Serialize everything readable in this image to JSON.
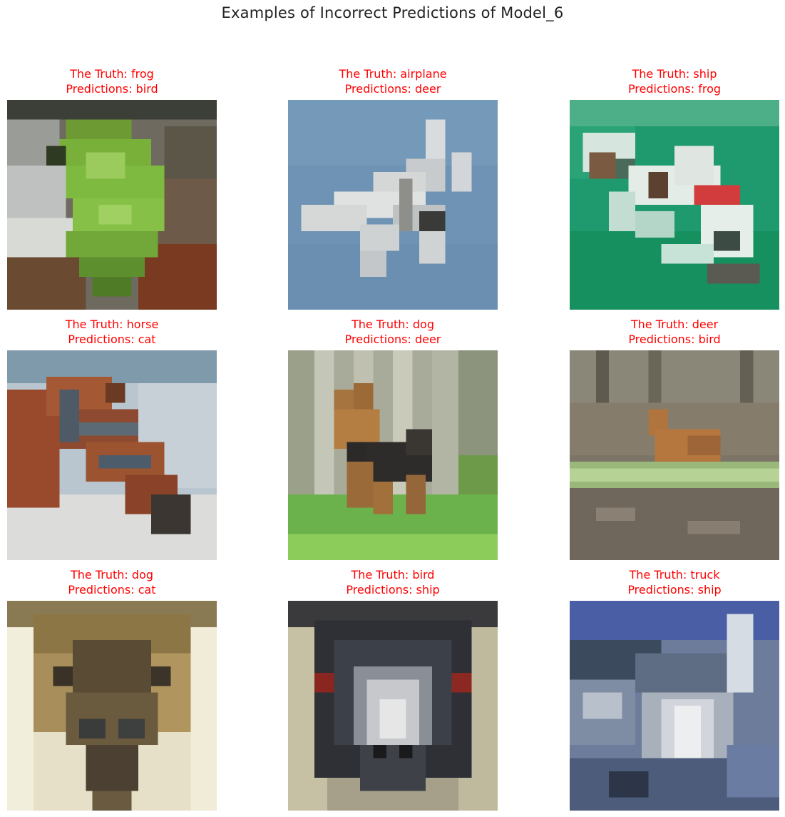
{
  "title": "Examples of Incorrect Predictions of Model_6",
  "panels": [
    {
      "truth": "The Truth: frog",
      "prediction": "Predictions: bird",
      "scene": "green-frog-on-rock"
    },
    {
      "truth": "The Truth: airplane",
      "prediction": "Predictions: deer",
      "scene": "white-jet-in-blue-sky"
    },
    {
      "truth": "The Truth: ship",
      "prediction": "Predictions: frog",
      "scene": "boat-on-green-water"
    },
    {
      "truth": "The Truth: horse",
      "prediction": "Predictions: cat",
      "scene": "brown-horse-head"
    },
    {
      "truth": "The Truth: dog",
      "prediction": "Predictions: deer",
      "scene": "terrier-on-grass"
    },
    {
      "truth": "The Truth: deer",
      "prediction": "Predictions: bird",
      "scene": "deer-in-undergrowth"
    },
    {
      "truth": "The Truth: dog",
      "prediction": "Predictions: cat",
      "scene": "dog-face-closeup"
    },
    {
      "truth": "The Truth: bird",
      "prediction": "Predictions: ship",
      "scene": "emu-face-closeup"
    },
    {
      "truth": "The Truth: truck",
      "prediction": "Predictions: ship",
      "scene": "truck-front"
    }
  ]
}
